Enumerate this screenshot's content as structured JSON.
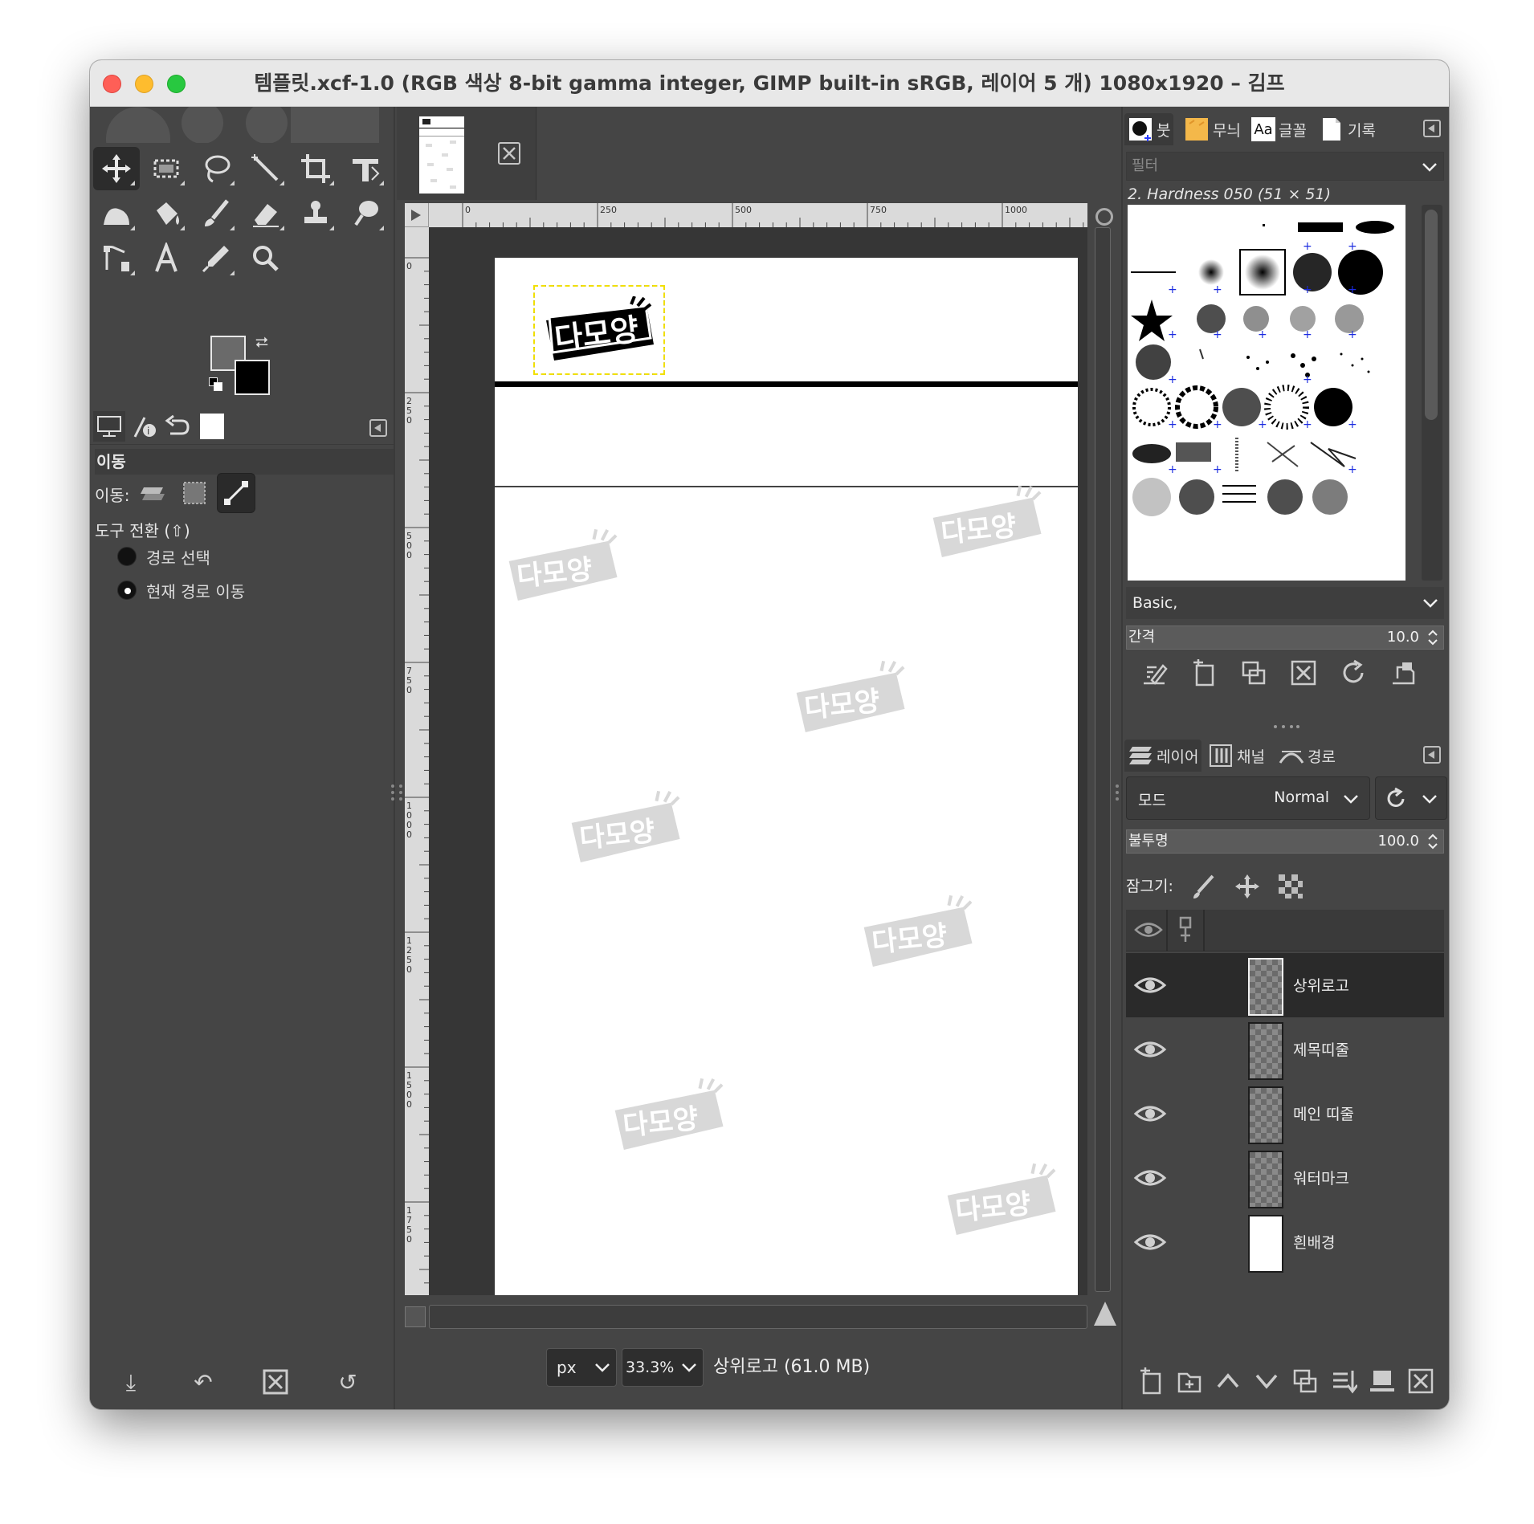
{
  "window": {
    "title": "템플릿.xcf-1.0 (RGB 색상 8-bit gamma integer, GIMP built-in sRGB, 레이어 5 개) 1080x1920 – 김프"
  },
  "toolbox": {
    "tools": [
      "move",
      "rect-select",
      "free-select",
      "fuzzy-select",
      "crop",
      "unified-transform",
      "warp",
      "bucket-fill",
      "paintbrush",
      "eraser",
      "clone",
      "smudge",
      "paths",
      "text",
      "color-picker",
      "zoom"
    ],
    "foreground_color": "#6a6a6a",
    "background_color": "#000000",
    "options": {
      "title": "이동",
      "move_label": "이동:",
      "toggle_title": "도구 전환 (⇧)",
      "radio_options": [
        "경로 선택",
        "현재 경로 이동"
      ],
      "radio_selected": 1
    }
  },
  "image_tab": {
    "close_icon": "close-icon"
  },
  "rulers": {
    "h_labels": [
      "0",
      "250",
      "500",
      "750",
      "1000"
    ],
    "v_labels": [
      "0",
      "250",
      "500",
      "750",
      "1000",
      "1250",
      "1500",
      "1750"
    ]
  },
  "canvas": {
    "logo_text": "다모양",
    "watermark_text": "다모양"
  },
  "statusbar": {
    "unit": "px",
    "zoom": "33.3%",
    "info": "상위로고 (61.0 MB)"
  },
  "dock_top": {
    "tabs": [
      "붓",
      "무늬",
      "글꼴",
      "기록"
    ],
    "font_tab_sample": "Aa",
    "filter_placeholder": "필터",
    "brush_name": "2. Hardness 050 (51 × 51)",
    "preset": "Basic,",
    "spacing_label": "간격",
    "spacing_value": "10.0"
  },
  "dock_layers": {
    "tabs": [
      "레이어",
      "채널",
      "경로"
    ],
    "mode_label": "모드",
    "mode_value": "Normal",
    "opacity_label": "불투명",
    "opacity_value": "100.0",
    "lock_label": "잠그기:",
    "layers": [
      {
        "name": "상위로고",
        "visible": true,
        "selected": true
      },
      {
        "name": "제목띠줄",
        "visible": true,
        "selected": false
      },
      {
        "name": "메인 띠줄",
        "visible": true,
        "selected": false
      },
      {
        "name": "워터마크",
        "visible": true,
        "selected": false
      },
      {
        "name": "흰배경",
        "visible": true,
        "selected": false
      }
    ]
  }
}
